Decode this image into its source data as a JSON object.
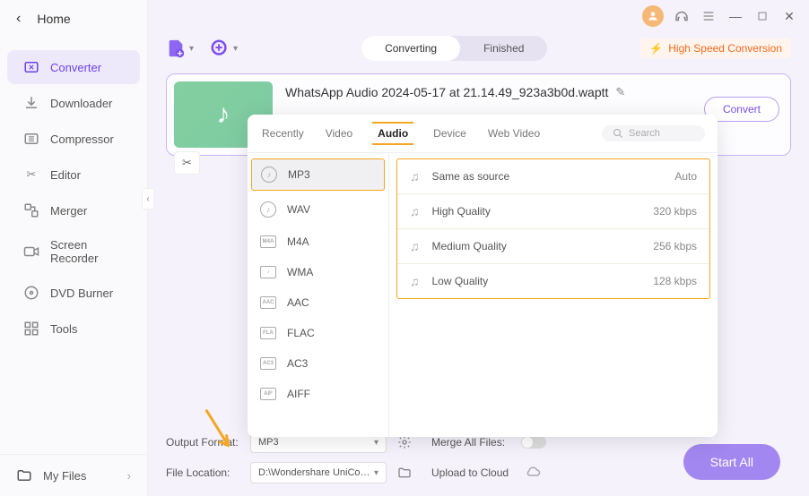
{
  "sidebar": {
    "home": "Home",
    "items": [
      {
        "label": "Converter"
      },
      {
        "label": "Downloader"
      },
      {
        "label": "Compressor"
      },
      {
        "label": "Editor"
      },
      {
        "label": "Merger"
      },
      {
        "label": "Screen Recorder"
      },
      {
        "label": "DVD Burner"
      },
      {
        "label": "Tools"
      }
    ],
    "footer": "My Files"
  },
  "toolbar": {
    "segment": {
      "converting": "Converting",
      "finished": "Finished"
    },
    "hs_label": "High Speed Conversion"
  },
  "file": {
    "name": "WhatsApp Audio 2024-05-17 at 21.14.49_923a3b0d.waptt",
    "convert_btn": "Convert"
  },
  "popup": {
    "tabs": {
      "recently": "Recently",
      "video": "Video",
      "audio": "Audio",
      "device": "Device",
      "web": "Web Video"
    },
    "search_placeholder": "Search",
    "formats": [
      {
        "label": "MP3"
      },
      {
        "label": "WAV"
      },
      {
        "label": "M4A"
      },
      {
        "label": "WMA"
      },
      {
        "label": "AAC"
      },
      {
        "label": "FLAC"
      },
      {
        "label": "AC3"
      },
      {
        "label": "AIFF"
      }
    ],
    "qualities": [
      {
        "label": "Same as source",
        "rate": "Auto"
      },
      {
        "label": "High Quality",
        "rate": "320 kbps"
      },
      {
        "label": "Medium Quality",
        "rate": "256 kbps"
      },
      {
        "label": "Low Quality",
        "rate": "128 kbps"
      }
    ]
  },
  "bottom": {
    "output_format_label": "Output Format:",
    "output_format_value": "MP3",
    "file_location_label": "File Location:",
    "file_location_value": "D:\\Wondershare UniConverter",
    "merge_label": "Merge All Files:",
    "cloud_label": "Upload to Cloud",
    "start_all": "Start All"
  }
}
